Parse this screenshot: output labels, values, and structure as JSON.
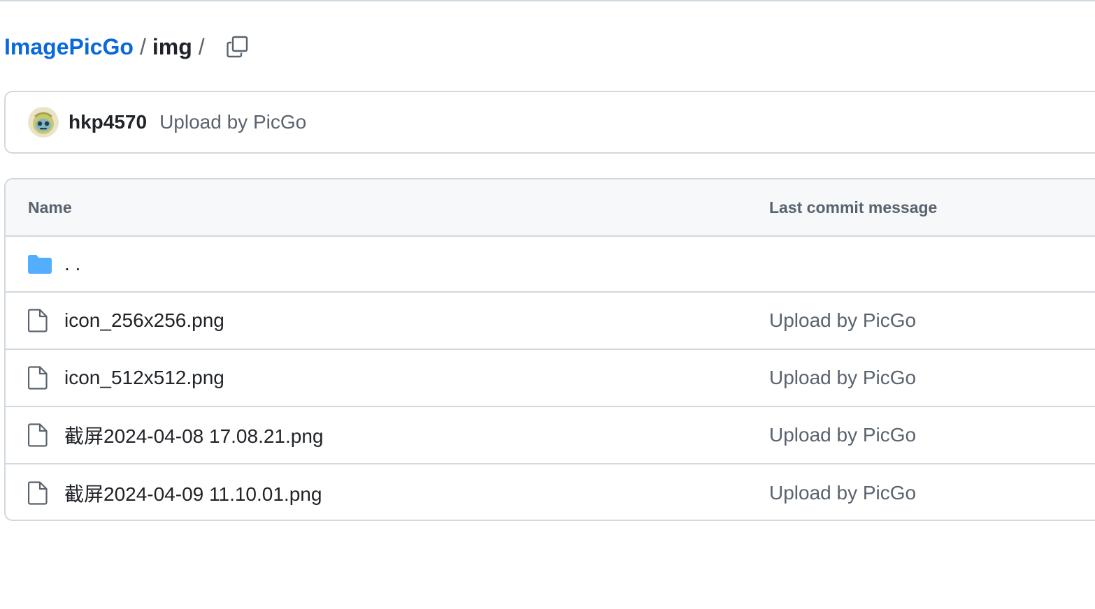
{
  "breadcrumb": {
    "repo": "ImagePicGo",
    "separator": "/",
    "directory": "img",
    "trailing_separator": "/",
    "copy_icon": "copy-icon"
  },
  "latest_commit": {
    "avatar_icon": "user-avatar",
    "author": "hkp4570",
    "message": "Upload by PicGo"
  },
  "table": {
    "headers": {
      "name": "Name",
      "message": "Last commit message"
    },
    "parent_row": {
      "icon": "folder-icon",
      "label": ". ."
    },
    "rows": [
      {
        "icon": "file-icon",
        "name": "icon_256x256.png",
        "message": "Upload by PicGo"
      },
      {
        "icon": "file-icon",
        "name": "icon_512x512.png",
        "message": "Upload by PicGo"
      },
      {
        "icon": "file-icon",
        "name": "截屏2024-04-08 17.08.21.png",
        "message": "Upload by PicGo"
      },
      {
        "icon": "file-icon",
        "name": "截屏2024-04-09 11.10.01.png",
        "message": "Upload by PicGo"
      }
    ]
  },
  "colors": {
    "link": "#0969da",
    "border": "#d1d9e0",
    "header_bg": "#f6f8fa",
    "muted_text": "#59636e",
    "folder": "#54aeff"
  }
}
